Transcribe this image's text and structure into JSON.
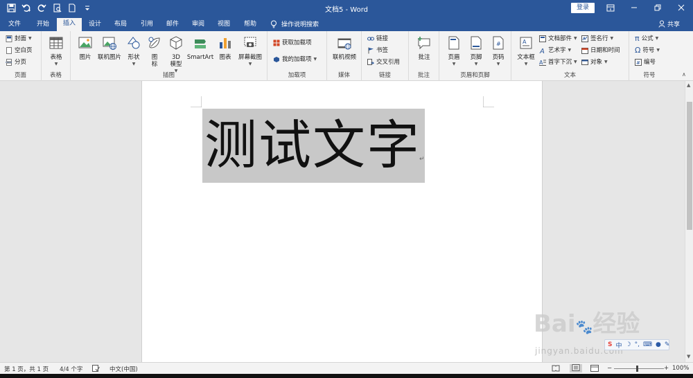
{
  "window": {
    "title": "文档5  -  Word",
    "login_label": "登录"
  },
  "tabs": [
    {
      "label": "文件"
    },
    {
      "label": "开始"
    },
    {
      "label": "插入"
    },
    {
      "label": "设计"
    },
    {
      "label": "布局"
    },
    {
      "label": "引用"
    },
    {
      "label": "邮件"
    },
    {
      "label": "审阅"
    },
    {
      "label": "视图"
    },
    {
      "label": "帮助"
    }
  ],
  "tell_me": "操作说明搜索",
  "share_label": "共享",
  "ribbon": {
    "pages": {
      "label": "页面",
      "cover": "封面",
      "blank": "空白页",
      "break": "分页"
    },
    "tables": {
      "label": "表格",
      "table": "表格"
    },
    "illustrations": {
      "label": "插图",
      "picture": "图片",
      "online_picture": "联机图片",
      "shapes": "形状",
      "icons_1": "图",
      "icons_2": "标",
      "model_1": "3D",
      "model_2": "模型",
      "smartart": "SmartArt",
      "chart": "图表",
      "screenshot": "屏幕截图"
    },
    "addins": {
      "label": "加载项",
      "get": "获取加载项",
      "mine": "我的加载项"
    },
    "media": {
      "label": "媒体",
      "online_video": "联机视频"
    },
    "links": {
      "label": "链接",
      "link": "链接",
      "bookmark": "书签",
      "cross_ref": "交叉引用"
    },
    "comments": {
      "label": "批注",
      "comment": "批注"
    },
    "header_footer": {
      "label": "页眉和页脚",
      "header": "页眉",
      "footer": "页脚",
      "page_number": "页码"
    },
    "text": {
      "label": "文本",
      "textbox": "文本框",
      "quick_parts": "文档部件",
      "wordart": "艺术字",
      "dropcap": "首字下沉",
      "signature": "签名行",
      "datetime": "日期和时间",
      "object": "对象"
    },
    "symbols": {
      "label": "符号",
      "equation": "公式",
      "symbol": "符号",
      "number": "编号"
    }
  },
  "document": {
    "text": "测试文字"
  },
  "status": {
    "page": "第 1 页，共 1 页",
    "words": "4/4 个字",
    "language": "中文(中国)",
    "zoom": "100%"
  },
  "watermark": {
    "brand": "Bai",
    "brand2": "经验",
    "url": "jingyan.baidu.com"
  },
  "ime": {
    "mode": "中"
  },
  "colors": {
    "accent": "#2b579a",
    "ribbon_bg": "#f3f3f3",
    "selection": "#c8c8c8"
  }
}
